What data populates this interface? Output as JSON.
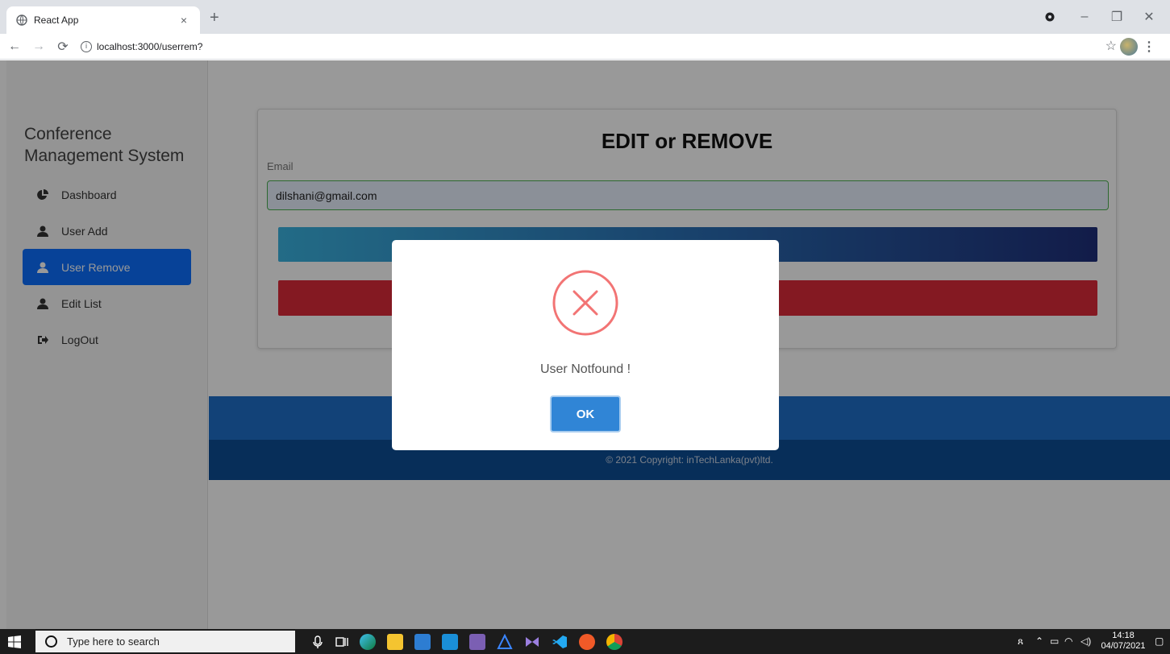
{
  "browser": {
    "tab_title": "React App",
    "tab_close": "×",
    "new_tab": "+",
    "url": "localhost:3000/userrem?",
    "controls": {
      "minimize": "–",
      "maximize": "❐",
      "close": "✕"
    }
  },
  "sidebar": {
    "brand_line1": "Conference",
    "brand_line2": "Management System",
    "items": [
      {
        "label": "Dashboard",
        "icon": "pie-chart-icon",
        "active": false
      },
      {
        "label": "User Add",
        "icon": "user-icon",
        "active": false
      },
      {
        "label": "User Remove",
        "icon": "user-icon",
        "active": true
      },
      {
        "label": "Edit List",
        "icon": "user-icon",
        "active": false
      },
      {
        "label": "LogOut",
        "icon": "sign-out-icon",
        "active": false
      }
    ]
  },
  "card": {
    "title": "EDIT or REMOVE",
    "email_label": "Email",
    "email_value": "dilshani@gmail.com"
  },
  "footer": {
    "copyright": "© 2021 Copyright: inTechLanka(pvt)ltd."
  },
  "modal": {
    "icon": "error-x-icon",
    "message": "User Notfound !",
    "ok_label": "OK"
  },
  "taskbar": {
    "search_placeholder": "Type here to search",
    "time": "14:18",
    "date": "04/07/2021"
  },
  "colors": {
    "primary": "#0d6efd",
    "danger": "#dc2a3a",
    "modal_ok": "#3085d6",
    "error_icon": "#f27474",
    "footer_band": "#1e6fc8",
    "footer_copy": "#0d4d94"
  }
}
